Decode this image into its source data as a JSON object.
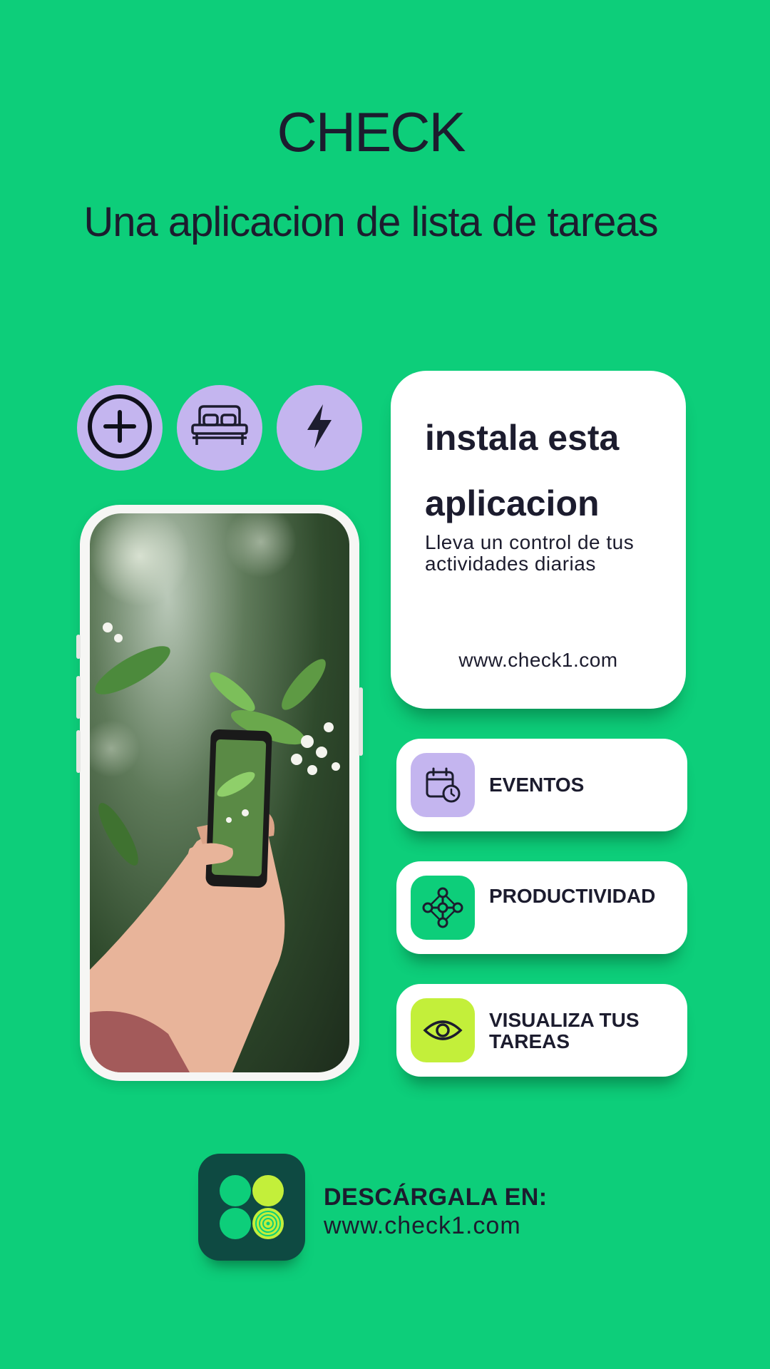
{
  "header": {
    "title": "CHECK",
    "subtitle": "Una aplicacion de lista de tareas"
  },
  "quick_actions": [
    {
      "icon": "plus-circle-icon"
    },
    {
      "icon": "bed-icon"
    },
    {
      "icon": "lightning-icon"
    }
  ],
  "phone": {
    "screen_image": "hand holding phone photographing white jasmine flowers"
  },
  "install_card": {
    "heading_line1": "instala esta",
    "heading_line2": "aplicacion",
    "description": "Lleva un control de tus actividades diarias",
    "url": "www.check1.com"
  },
  "features": [
    {
      "label": "EVENTOS",
      "icon": "calendar-clock-icon",
      "icon_bg": "#c4b5ef"
    },
    {
      "label": "PRODUCTIVIDAD",
      "icon": "nodes-icon",
      "icon_bg": "#0dce7a"
    },
    {
      "label": "VISUALIZA TUS TAREAS",
      "icon": "eye-icon",
      "icon_bg": "#c3ef3a"
    }
  ],
  "download": {
    "label": "DESCÁRGALA EN:",
    "url": "www.check1.com"
  },
  "colors": {
    "background": "#0dce7a",
    "lavender": "#c4b5ef",
    "lime": "#c3ef3a",
    "dark_teal": "#0e4a42",
    "text": "#1c1c2e"
  }
}
